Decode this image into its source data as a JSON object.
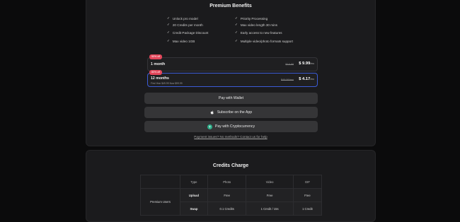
{
  "premium": {
    "title": "Premium Benefits",
    "benefits_left": [
      "Unlock pro model",
      "20 Credits per month",
      "Credit Package Discount",
      "Max video 1GB"
    ],
    "benefits_right": [
      "Priority Processing",
      "Max video length 30 mins",
      "Early access to new features",
      "Multiple video/photo formats support"
    ],
    "plans": [
      {
        "badge": "50% off",
        "name": "1 month",
        "sub": "",
        "old_price": "$19.98",
        "price": "$ 9.99",
        "unit": "/mo",
        "selected": false
      },
      {
        "badge": "80% off",
        "name": "12 months",
        "sub": "First Year $49.99 Now $99.99",
        "old_price": "$49.99/mo",
        "price": "$ 4.17",
        "unit": "/mo",
        "selected": true
      }
    ],
    "buttons": {
      "wallet": "Pay with Wallet",
      "app": "Subscribe on the App",
      "crypto": "Pay with Cryptocurrency"
    },
    "help_link": "Payment issues? No methods? Contact us for help"
  },
  "credits": {
    "title": "Credits Charge",
    "headers": [
      "",
      "Type",
      "Photo",
      "Video",
      "GIF"
    ],
    "row_group": "Premium Users",
    "rows": [
      {
        "type": "Upload",
        "photo": "Free",
        "video": "Free",
        "gif": "Free"
      },
      {
        "type": "Swap",
        "photo": "0.1 Credits",
        "video": "1 Credit / 15s",
        "gif": "1 Credit"
      }
    ]
  },
  "colors": {
    "accent_selected": "#3b5bd6",
    "badge": "#e2465a",
    "tether": "#2fb08b"
  },
  "icons": {
    "benefit": "check-icon",
    "app": "apple-icon",
    "crypto": "tether-icon"
  }
}
